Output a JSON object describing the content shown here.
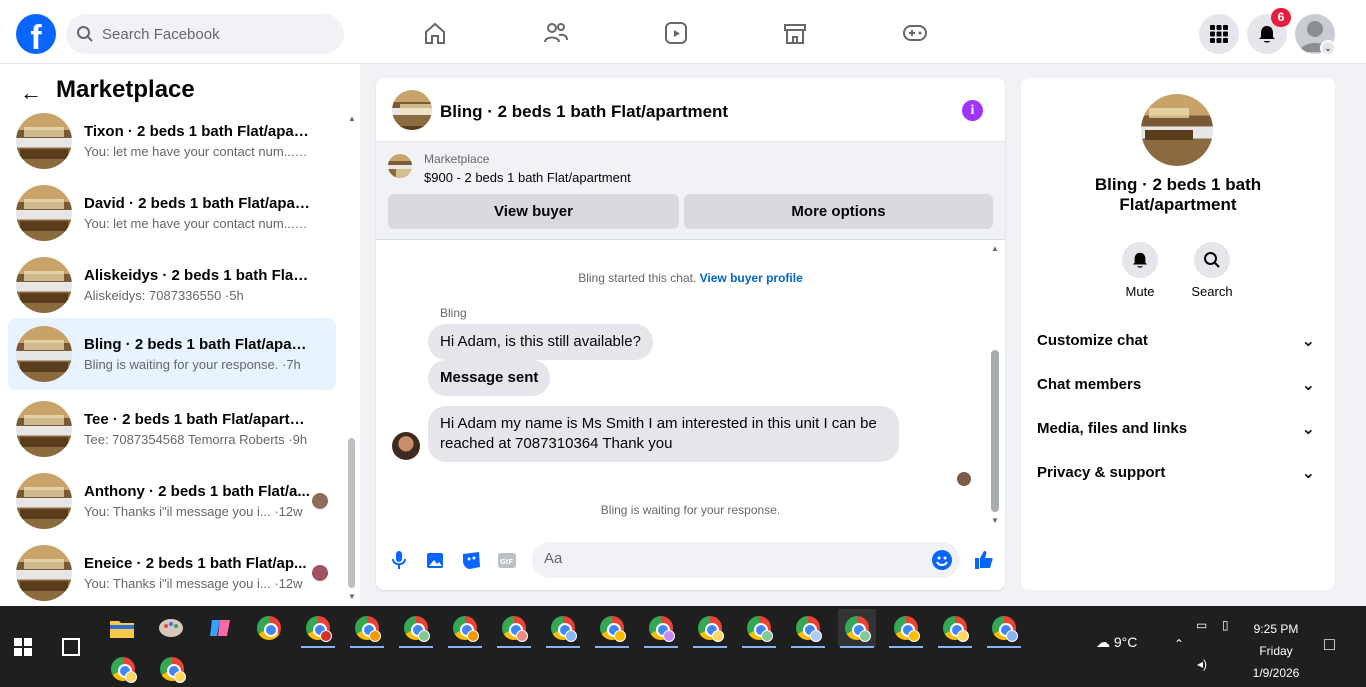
{
  "header": {
    "search_placeholder": "Search Facebook",
    "notification_count": "6"
  },
  "nav": [
    "home-icon",
    "friends-icon",
    "watch-icon",
    "marketplace-icon",
    "gaming-icon"
  ],
  "sidebar": {
    "title": "Marketplace",
    "items": [
      {
        "name": "Tixon · 2 beds 1 bath Flat/apart...",
        "preview": "You: let me have your contact num... ·7m"
      },
      {
        "name": "David · 2 beds 1 bath Flat/apart...",
        "preview": "You: let me have your contact num... ·7m"
      },
      {
        "name": "Aliskeidys · 2 beds 1 bath Flat/ap...",
        "preview": "Aliskeidys: 7087336550 ·5h"
      },
      {
        "name": "Bling · 2 beds 1 bath Flat/apart...",
        "preview": "Bling is waiting for your response. ·7h",
        "active": true
      },
      {
        "name": "Tee · 2 beds 1 bath Flat/apartment",
        "preview": "Tee: 7087354568 Temorra Roberts ·9h"
      },
      {
        "name": "Anthony · 2 beds 1 bath Flat/a...",
        "preview": "You: Thanks i\"il message you i... ·12w"
      },
      {
        "name": "Eneice · 2 beds 1 bath Flat/ap...",
        "preview": "You: Thanks i\"il message you i... ·12w"
      }
    ]
  },
  "chat": {
    "title": "Bling · 2 beds 1 bath Flat/apartment",
    "listing_kicker": "Marketplace",
    "listing_title": "$900 - 2 beds 1 bath Flat/apartment",
    "view_buyer": "View buyer",
    "more_options": "More options",
    "started": "Bling started this chat.",
    "view_profile": "View buyer profile",
    "sender": "Bling",
    "messages": [
      "Hi Adam, is this still available?",
      "Message sent",
      "Hi Adam my name is Ms Smith I am interested in this unit I can be reached at 7087310364 Thank you"
    ],
    "waiting": "Bling is waiting for your response.",
    "composer_placeholder": "Aa"
  },
  "info": {
    "title": "Bling · 2 beds 1 bath Flat/apartment",
    "mute": "Mute",
    "search": "Search",
    "sections": [
      "Customize chat",
      "Chat members",
      "Media, files and links",
      "Privacy & support"
    ]
  },
  "taskbar": {
    "weather": "9°C",
    "time": "9:25 PM",
    "day": "Friday",
    "date": "1/9/2026",
    "colors": {
      "accent": "#8ab4f8"
    }
  }
}
